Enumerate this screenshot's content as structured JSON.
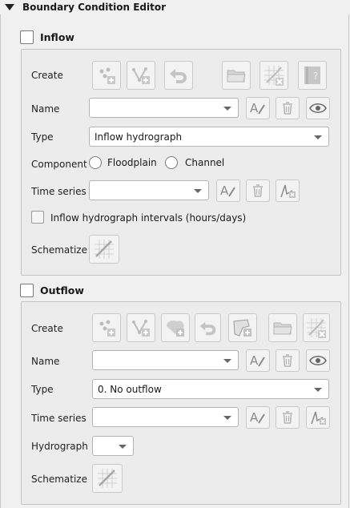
{
  "header": {
    "title": "Boundary Condition Editor"
  },
  "inflow": {
    "section_label": "Inflow",
    "labels": {
      "create": "Create",
      "name": "Name",
      "type": "Type",
      "component": "Component",
      "time_series": "Time series",
      "schematize": "Schematize"
    },
    "name_value": "",
    "type_value": "Inflow hydrograph",
    "time_series_value": "",
    "component_options": [
      "Floodplain",
      "Channel"
    ],
    "intervals_label": "Inflow hydrograph intervals (hours/days)"
  },
  "outflow": {
    "section_label": "Outflow",
    "labels": {
      "create": "Create",
      "name": "Name",
      "type": "Type",
      "time_series": "Time series",
      "hydrograph": "Hydrograph",
      "schematize": "Schematize"
    },
    "name_value": "",
    "type_value": "0. No outflow",
    "time_series_value": "",
    "hydrograph_value": ""
  },
  "icons": {
    "point": "add-point-icon",
    "line": "add-line-icon",
    "polygon": "add-polygon-icon",
    "revert": "revert-icon",
    "open": "folder-icon",
    "delete_schema": "delete-schema-icon",
    "help": "help-icon",
    "rename": "rename-icon",
    "trash": "trash-icon",
    "eye": "eye-icon",
    "plot": "plot-icon",
    "schematize": "schematize-icon"
  }
}
